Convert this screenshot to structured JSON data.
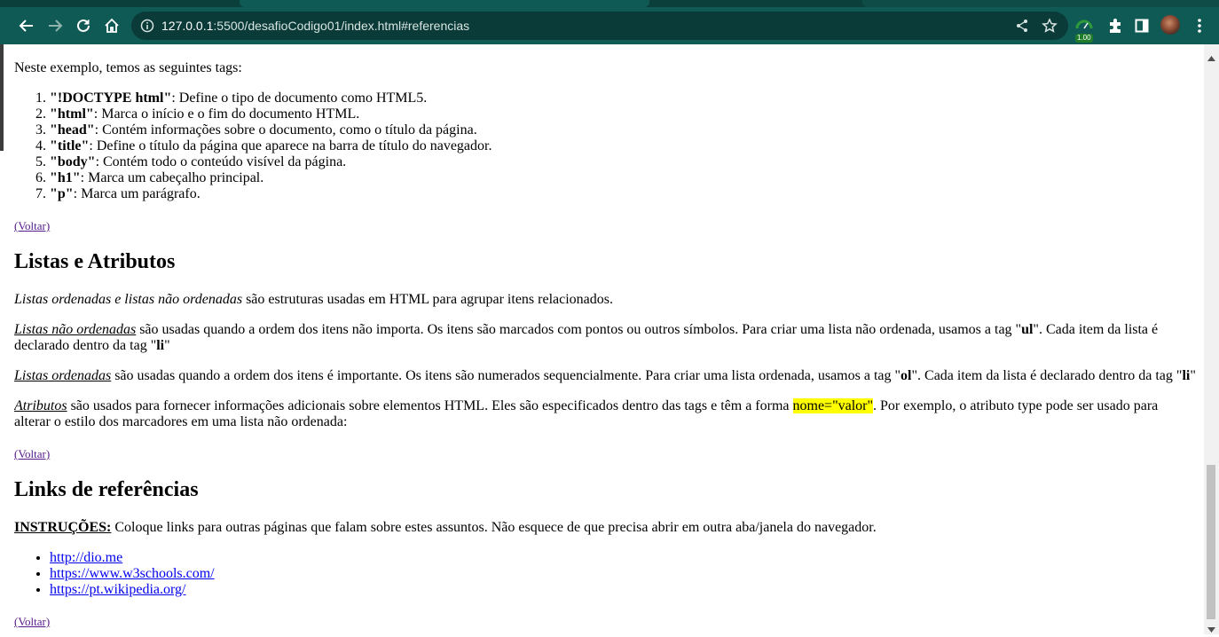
{
  "browser": {
    "url_host": "127.0.0.1",
    "url_rest": ":5500/desafioCodigo01/index.html#referencias",
    "extension_badge": "1.00",
    "accent_color": "#105a55"
  },
  "page": {
    "intro": "Neste exemplo, temos as seguintes tags:",
    "tag_list": [
      {
        "tag": "\"!DOCTYPE html\"",
        "desc": ": Define o tipo de documento como HTML5."
      },
      {
        "tag": "\"html\"",
        "desc": ": Marca o início e o fim do documento HTML."
      },
      {
        "tag": "\"head\"",
        "desc": ": Contém informações sobre o documento, como o título da página."
      },
      {
        "tag": "\"title\"",
        "desc": ": Define o título da página que aparece na barra de título do navegador."
      },
      {
        "tag": "\"body\"",
        "desc": ": Contém todo o conteúdo visível da página."
      },
      {
        "tag": "\"h1\"",
        "desc": ": Marca um cabeçalho principal."
      },
      {
        "tag": "\"p\"",
        "desc": ": Marca um parágrafo."
      }
    ],
    "voltar": "(Voltar)",
    "listas": {
      "heading": "Listas e Atributos",
      "p1_em": "Listas ordenadas e listas não ordenadas",
      "p1_rest": " são estruturas usadas em HTML para agrupar itens relacionados.",
      "p2_u": "Listas não ordenadas",
      "p2_a": " são usadas quando a ordem dos itens não importa. Os itens são marcados com pontos ou outros símbolos. Para criar uma lista não ordenada, usamos a tag \"",
      "p2_b1": "ul",
      "p2_c": "\". Cada item da lista é declarado dentro da tag \"",
      "p2_b2": "li",
      "p2_d": "\"",
      "p3_u": "Listas ordenadas",
      "p3_a": " são usadas quando a ordem dos itens é importante. Os itens são numerados sequencialmente. Para criar uma lista ordenada, usamos a tag \"",
      "p3_b1": "ol",
      "p3_c": "\". Cada item da lista é declarado dentro da tag \"",
      "p3_b2": "li",
      "p3_d": "\"",
      "p4_u": "Atributos",
      "p4_a": " são usados para fornecer informações adicionais sobre elementos HTML. Eles são especificados dentro das tags e têm a forma ",
      "p4_mark": "nome=\"valor\"",
      "p4_b": ". Por exemplo, o atributo type pode ser usado para alterar o estilo dos marcadores em uma lista não ordenada:"
    },
    "links": {
      "heading": "Links de referências",
      "instr_label": "INSTRUÇÕES:",
      "instr_text": " Coloque links para outras páginas que falam sobre estes assuntos. Não esquece de que precisa abrir em outra aba/janela do navegador.",
      "items": [
        "http://dio.me",
        "https://www.w3schools.com/",
        "https://pt.wikipedia.org/"
      ]
    }
  }
}
